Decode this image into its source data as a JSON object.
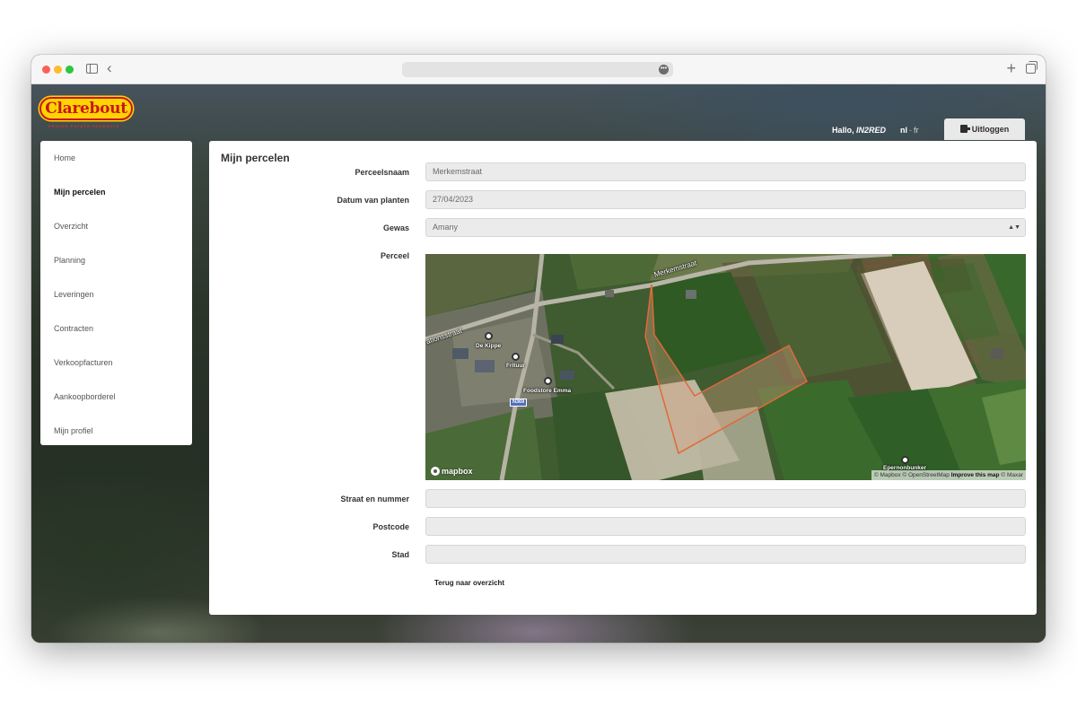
{
  "browser": {
    "more_icon": "ellipsis-icon",
    "new_tab_icon": "plus-icon",
    "tabs_icon": "tabs-overview-icon",
    "back_icon": "chevron-left-icon",
    "sidebar_icon": "sidebar-toggle-icon"
  },
  "header": {
    "logo_text": "Clarebout",
    "logo_subtitle": "FROZEN POTATO PRODUCTS",
    "greeting_prefix": "Hallo,",
    "username": "IN2RED",
    "lang_active": "nl",
    "lang_sep": "-",
    "lang_other": "fr",
    "logout_label": "Uitloggen",
    "logout_icon": "logout-icon"
  },
  "sidebar": {
    "items": [
      {
        "label": "Home",
        "active": false
      },
      {
        "label": "Mijn percelen",
        "active": true
      },
      {
        "label": "Overzicht",
        "active": false
      },
      {
        "label": "Planning",
        "active": false
      },
      {
        "label": "Leveringen",
        "active": false
      },
      {
        "label": "Contracten",
        "active": false
      },
      {
        "label": "Verkoopfacturen",
        "active": false
      },
      {
        "label": "Aankoopborderel",
        "active": false
      },
      {
        "label": "Mijn profiel",
        "active": false
      }
    ]
  },
  "main": {
    "title": "Mijn percelen",
    "fields": {
      "perceelsnaam": {
        "label": "Perceelsnaam",
        "value": "Merkemstraat"
      },
      "datum": {
        "label": "Datum van planten",
        "value": "27/04/2023"
      },
      "gewas": {
        "label": "Gewas",
        "value": "Amany"
      },
      "perceel": {
        "label": "Perceel"
      },
      "straat": {
        "label": "Straat en nummer",
        "value": ""
      },
      "postcode": {
        "label": "Postcode",
        "value": ""
      },
      "stad": {
        "label": "Stad",
        "value": ""
      }
    },
    "back_link": "Terug naar overzicht"
  },
  "map": {
    "road_merkem": "Merkemstraat",
    "road_stations": "ationsstraat",
    "poi_kippe": "De Kippe",
    "poi_frituur": "Frituur",
    "poi_foodstore": "Foodstore Emma",
    "poi_epernon": "Epernonbunker",
    "road_shield": "N369",
    "logo": "mapbox",
    "attrib_mapbox": "© Mapbox",
    "attrib_osm": "© OpenStreetMap",
    "attrib_improve": "Improve this map",
    "attrib_maxar": "© Maxar",
    "parcel_color": "#e0693a"
  },
  "colors": {
    "brand_yellow": "#ffd400",
    "brand_red": "#c9161d"
  }
}
